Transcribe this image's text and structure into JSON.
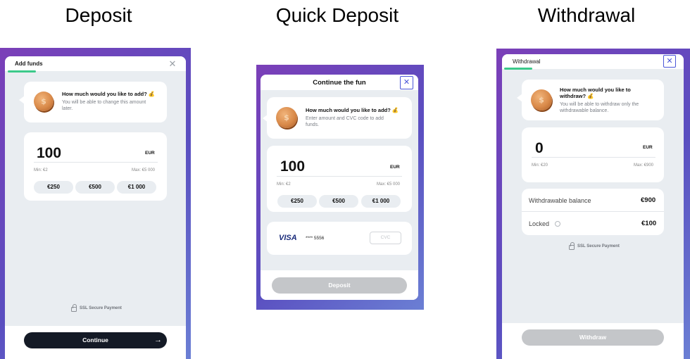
{
  "headings": {
    "deposit": "Deposit",
    "quick": "Quick Deposit",
    "withdrawal": "Withdrawal"
  },
  "deposit": {
    "tab": "Add funds",
    "question": "How much would you like to add? 💰",
    "subtitle": "You will be able to change this amount later.",
    "amount": "100",
    "currency": "EUR",
    "min": "Min: €2",
    "max": "Max: €5 000",
    "chips": [
      "€250",
      "€500",
      "€1 000"
    ],
    "ssl": "SSL Secure Payment",
    "button": "Continue",
    "button_icon": "→"
  },
  "quick": {
    "title": "Continue the fun",
    "question": "How much would you like to add? 💰",
    "subtitle": "Enter amount and CVC code to add funds.",
    "amount": "100",
    "currency": "EUR",
    "min": "Min: €2",
    "max": "Max: €5 000",
    "chips": [
      "€250",
      "€500",
      "€1 000"
    ],
    "card_brand": "VISA",
    "card_number": "**** 5556",
    "cvc_placeholder": "CVC",
    "button": "Deposit"
  },
  "withdrawal": {
    "tab": "Withdrawal",
    "question": "How much would you like to withdraw? 💰",
    "subtitle": "You will be able to withdraw only the withdrawable balance.",
    "amount": "0",
    "currency": "EUR",
    "min": "Min: €20",
    "max": "Max: €900",
    "withdrawable_label": "Withdrawable balance",
    "withdrawable_value": "€900",
    "locked_label": "Locked",
    "locked_value": "€100",
    "ssl": "SSL Secure Payment",
    "button": "Withdraw"
  },
  "icons": {
    "close": "close-icon",
    "coin": "coin-icon",
    "lock": "lock-icon",
    "arrow": "arrow-right-icon",
    "info": "info-icon"
  },
  "colors": {
    "accent_green": "#3cc98a",
    "dark_button": "#141a26",
    "disabled_button": "#c4c6c9",
    "frame_purple": "#7b3fb8",
    "close_blue": "#4a56d8"
  }
}
